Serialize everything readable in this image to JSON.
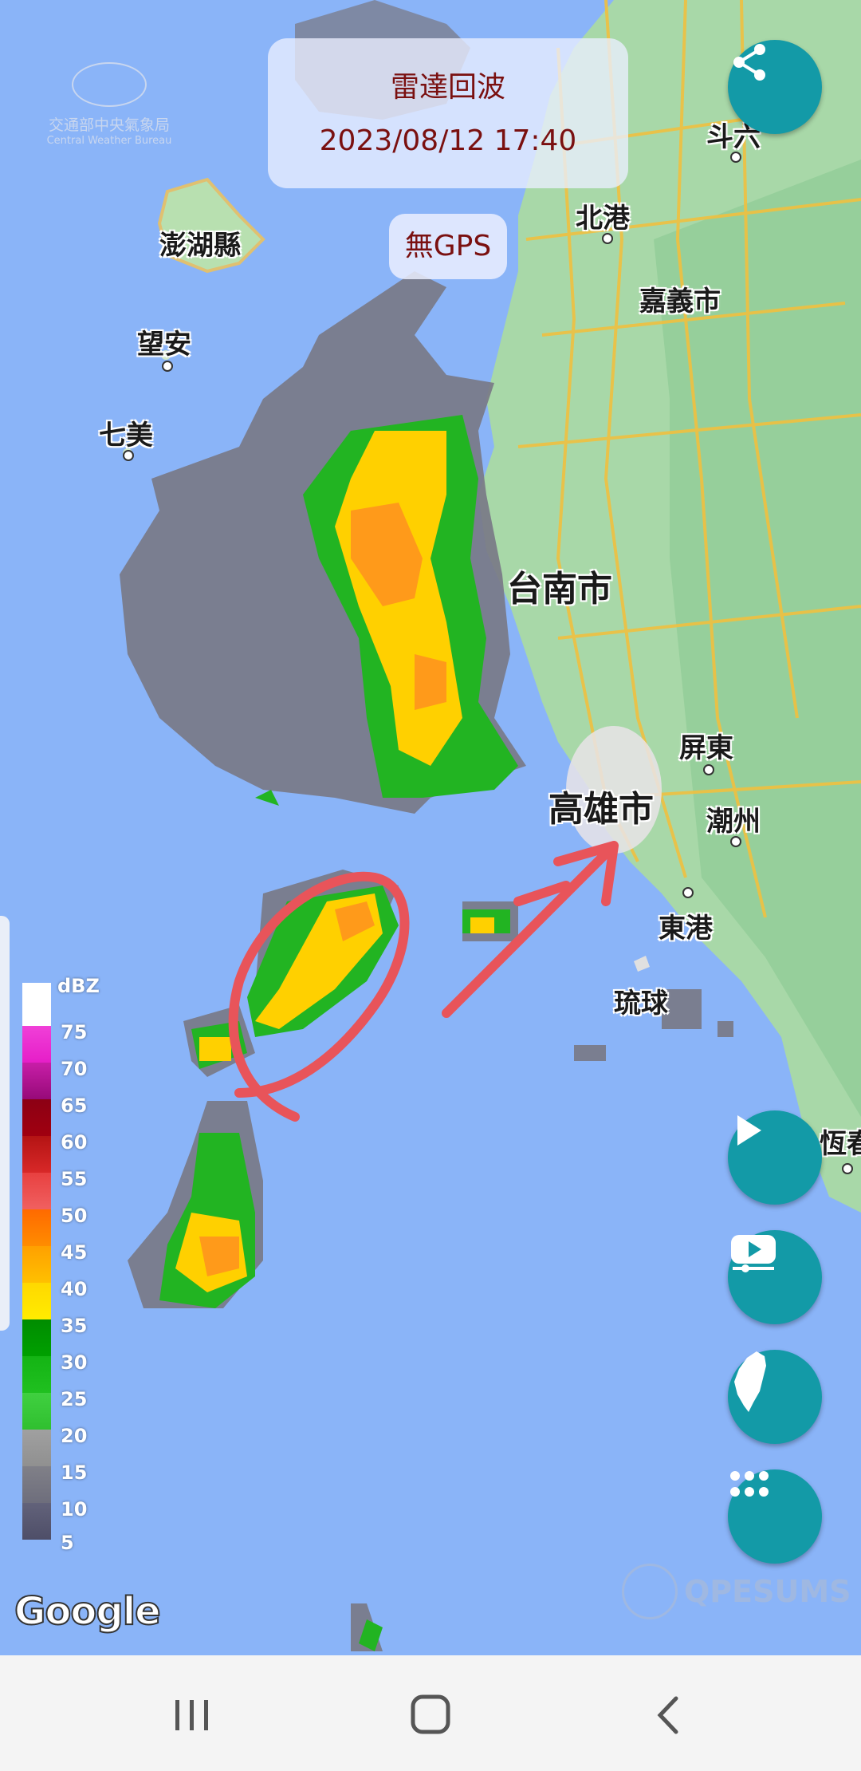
{
  "header": {
    "title": "雷達回波",
    "datetime": "2023/08/12 17:40"
  },
  "gps_badge": "無GPS",
  "agency": {
    "name_zh": "交通部中央氣象局",
    "name_en": "Central Weather Bureau"
  },
  "map_labels": {
    "penghu": "澎湖縣",
    "wangan": "望安",
    "qimei": "七美",
    "douliu": "斗六",
    "beigang": "北港",
    "chiayi": "嘉義市",
    "tainan": "台南市",
    "kaohsiung": "高雄市",
    "pingtung": "屏東",
    "chaozhou": "潮州",
    "donggang": "東港",
    "liuqiu": "琉球",
    "hengchun": "恆春"
  },
  "legend": {
    "unit": "dBZ",
    "ticks": [
      "75",
      "70",
      "65",
      "60",
      "55",
      "50",
      "45",
      "40",
      "35",
      "30",
      "25",
      "20",
      "15",
      "10",
      "5"
    ],
    "colors": [
      "#ffffff",
      "#e61ec8",
      "#b41496",
      "#8c0014",
      "#c80f0f",
      "#f05050",
      "#ff7800",
      "#ffae00",
      "#ffdc00",
      "#00a000",
      "#14be14",
      "#40d040",
      "#9a9a9a",
      "#7a7a86",
      "#5a5a70"
    ]
  },
  "buttons": {
    "share": "share-icon",
    "play": "play-icon",
    "video": "youtube-icon",
    "taiwan": "taiwan-map-icon",
    "menu": "grid-menu-icon"
  },
  "branding": {
    "google": "Google",
    "qpesums": "QPESUMS"
  },
  "navbar": {
    "recent": "recent-apps-icon",
    "home": "home-icon",
    "back": "back-icon"
  }
}
